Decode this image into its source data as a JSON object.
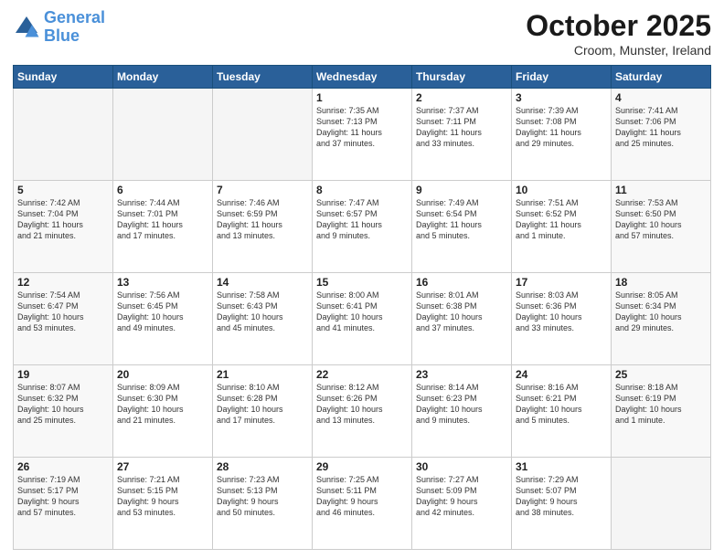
{
  "header": {
    "logo_line1": "General",
    "logo_line2": "Blue",
    "month": "October 2025",
    "location": "Croom, Munster, Ireland"
  },
  "weekdays": [
    "Sunday",
    "Monday",
    "Tuesday",
    "Wednesday",
    "Thursday",
    "Friday",
    "Saturday"
  ],
  "weeks": [
    [
      {
        "day": "",
        "info": ""
      },
      {
        "day": "",
        "info": ""
      },
      {
        "day": "",
        "info": ""
      },
      {
        "day": "1",
        "info": "Sunrise: 7:35 AM\nSunset: 7:13 PM\nDaylight: 11 hours\nand 37 minutes."
      },
      {
        "day": "2",
        "info": "Sunrise: 7:37 AM\nSunset: 7:11 PM\nDaylight: 11 hours\nand 33 minutes."
      },
      {
        "day": "3",
        "info": "Sunrise: 7:39 AM\nSunset: 7:08 PM\nDaylight: 11 hours\nand 29 minutes."
      },
      {
        "day": "4",
        "info": "Sunrise: 7:41 AM\nSunset: 7:06 PM\nDaylight: 11 hours\nand 25 minutes."
      }
    ],
    [
      {
        "day": "5",
        "info": "Sunrise: 7:42 AM\nSunset: 7:04 PM\nDaylight: 11 hours\nand 21 minutes."
      },
      {
        "day": "6",
        "info": "Sunrise: 7:44 AM\nSunset: 7:01 PM\nDaylight: 11 hours\nand 17 minutes."
      },
      {
        "day": "7",
        "info": "Sunrise: 7:46 AM\nSunset: 6:59 PM\nDaylight: 11 hours\nand 13 minutes."
      },
      {
        "day": "8",
        "info": "Sunrise: 7:47 AM\nSunset: 6:57 PM\nDaylight: 11 hours\nand 9 minutes."
      },
      {
        "day": "9",
        "info": "Sunrise: 7:49 AM\nSunset: 6:54 PM\nDaylight: 11 hours\nand 5 minutes."
      },
      {
        "day": "10",
        "info": "Sunrise: 7:51 AM\nSunset: 6:52 PM\nDaylight: 11 hours\nand 1 minute."
      },
      {
        "day": "11",
        "info": "Sunrise: 7:53 AM\nSunset: 6:50 PM\nDaylight: 10 hours\nand 57 minutes."
      }
    ],
    [
      {
        "day": "12",
        "info": "Sunrise: 7:54 AM\nSunset: 6:47 PM\nDaylight: 10 hours\nand 53 minutes."
      },
      {
        "day": "13",
        "info": "Sunrise: 7:56 AM\nSunset: 6:45 PM\nDaylight: 10 hours\nand 49 minutes."
      },
      {
        "day": "14",
        "info": "Sunrise: 7:58 AM\nSunset: 6:43 PM\nDaylight: 10 hours\nand 45 minutes."
      },
      {
        "day": "15",
        "info": "Sunrise: 8:00 AM\nSunset: 6:41 PM\nDaylight: 10 hours\nand 41 minutes."
      },
      {
        "day": "16",
        "info": "Sunrise: 8:01 AM\nSunset: 6:38 PM\nDaylight: 10 hours\nand 37 minutes."
      },
      {
        "day": "17",
        "info": "Sunrise: 8:03 AM\nSunset: 6:36 PM\nDaylight: 10 hours\nand 33 minutes."
      },
      {
        "day": "18",
        "info": "Sunrise: 8:05 AM\nSunset: 6:34 PM\nDaylight: 10 hours\nand 29 minutes."
      }
    ],
    [
      {
        "day": "19",
        "info": "Sunrise: 8:07 AM\nSunset: 6:32 PM\nDaylight: 10 hours\nand 25 minutes."
      },
      {
        "day": "20",
        "info": "Sunrise: 8:09 AM\nSunset: 6:30 PM\nDaylight: 10 hours\nand 21 minutes."
      },
      {
        "day": "21",
        "info": "Sunrise: 8:10 AM\nSunset: 6:28 PM\nDaylight: 10 hours\nand 17 minutes."
      },
      {
        "day": "22",
        "info": "Sunrise: 8:12 AM\nSunset: 6:26 PM\nDaylight: 10 hours\nand 13 minutes."
      },
      {
        "day": "23",
        "info": "Sunrise: 8:14 AM\nSunset: 6:23 PM\nDaylight: 10 hours\nand 9 minutes."
      },
      {
        "day": "24",
        "info": "Sunrise: 8:16 AM\nSunset: 6:21 PM\nDaylight: 10 hours\nand 5 minutes."
      },
      {
        "day": "25",
        "info": "Sunrise: 8:18 AM\nSunset: 6:19 PM\nDaylight: 10 hours\nand 1 minute."
      }
    ],
    [
      {
        "day": "26",
        "info": "Sunrise: 7:19 AM\nSunset: 5:17 PM\nDaylight: 9 hours\nand 57 minutes."
      },
      {
        "day": "27",
        "info": "Sunrise: 7:21 AM\nSunset: 5:15 PM\nDaylight: 9 hours\nand 53 minutes."
      },
      {
        "day": "28",
        "info": "Sunrise: 7:23 AM\nSunset: 5:13 PM\nDaylight: 9 hours\nand 50 minutes."
      },
      {
        "day": "29",
        "info": "Sunrise: 7:25 AM\nSunset: 5:11 PM\nDaylight: 9 hours\nand 46 minutes."
      },
      {
        "day": "30",
        "info": "Sunrise: 7:27 AM\nSunset: 5:09 PM\nDaylight: 9 hours\nand 42 minutes."
      },
      {
        "day": "31",
        "info": "Sunrise: 7:29 AM\nSunset: 5:07 PM\nDaylight: 9 hours\nand 38 minutes."
      },
      {
        "day": "",
        "info": ""
      }
    ]
  ]
}
